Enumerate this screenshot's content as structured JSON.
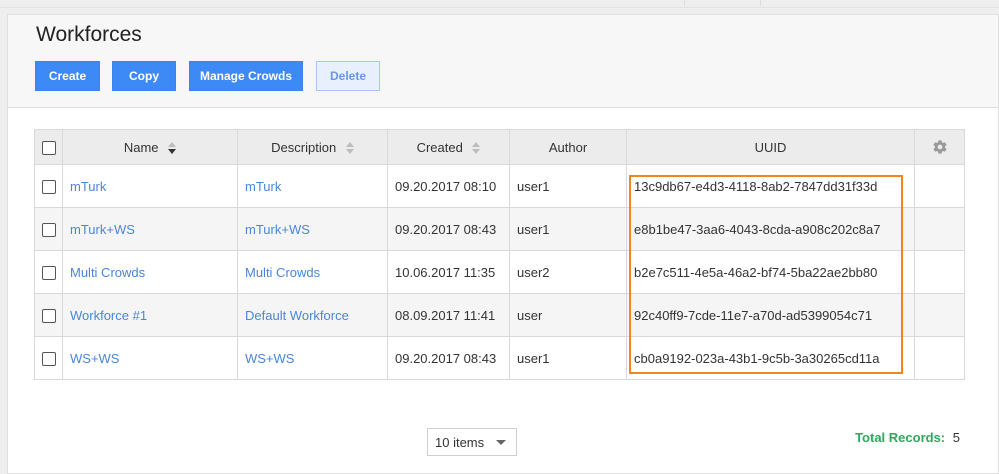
{
  "page": {
    "title": "Workforces"
  },
  "toolbar": {
    "create_label": "Create",
    "copy_label": "Copy",
    "manage_crowds_label": "Manage Crowds",
    "delete_label": "Delete"
  },
  "table": {
    "columns": {
      "name": "Name",
      "description": "Description",
      "created": "Created",
      "author": "Author",
      "uuid": "UUID"
    },
    "sort": {
      "column": "Name",
      "direction": "descending"
    },
    "rows": [
      {
        "name": "mTurk",
        "description": "mTurk",
        "created": "09.20.2017 08:10",
        "author": "user1",
        "uuid": "13c9db67-e4d3-4118-8ab2-7847dd31f33d"
      },
      {
        "name": "mTurk+WS",
        "description": "mTurk+WS",
        "created": "09.20.2017 08:43",
        "author": "user1",
        "uuid": "e8b1be47-3aa6-4043-8cda-a908c202c8a7"
      },
      {
        "name": "Multi Crowds",
        "description": "Multi Crowds",
        "created": "10.06.2017 11:35",
        "author": "user2",
        "uuid": "b2e7c511-4e5a-46a2-bf74-5ba22ae2bb80"
      },
      {
        "name": "Workforce #1",
        "description": "Default Workforce",
        "created": "08.09.2017 11:41",
        "author": "user",
        "uuid": "92c40ff9-7cde-11e7-a70d-ad5399054c71"
      },
      {
        "name": "WS+WS",
        "description": "WS+WS",
        "created": "09.20.2017 08:43",
        "author": "user1",
        "uuid": "cb0a9192-023a-43b1-9c5b-3a30265cd11a"
      }
    ]
  },
  "pagination": {
    "page_size_selected": "10 items"
  },
  "footer": {
    "total_label": "Total Records:",
    "total_value": "5"
  },
  "icons": {
    "settings": "gear-icon",
    "sort": "sort-icon",
    "dropdown": "chevron-down-icon"
  },
  "colors": {
    "primary_button": "#3d8af7",
    "link": "#4a86d8",
    "highlight": "#f0871e",
    "total_label": "#2bab5b"
  }
}
